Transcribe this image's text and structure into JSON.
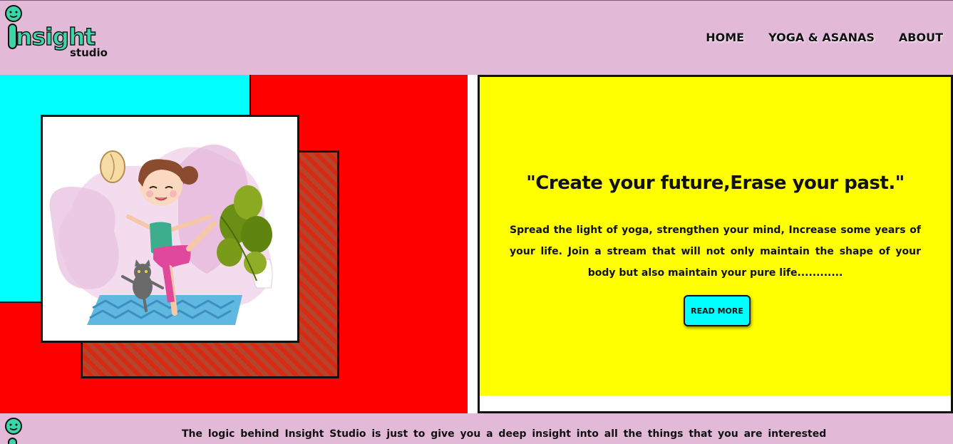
{
  "header": {
    "logo_word": "nsight",
    "logo_sub": "studio",
    "nav": [
      "HOME",
      "YOGA & ASANAS",
      "ABOUT"
    ]
  },
  "hero": {
    "quote": "\"Create your future,Erase your past.\"",
    "tagline": "Spread the light of yoga, strengthen your mind, Increase some years of your life. Join a stream that will not only maintain the shape of your body but also maintain your pure life............",
    "button_label": "READ MORE"
  },
  "footer": {
    "text": "The logic behind Insight Studio is just to give you a deep insight into all the things that you are interested"
  },
  "colors": {
    "header_bg": "#e2bad8",
    "accent_cyan": "#00ffff",
    "accent_red": "#ff0000",
    "panel_yellow": "#ffff00",
    "logo_green": "#3bd6a8"
  },
  "icons": [
    "logo-face-icon",
    "yoga-girl-illustration",
    "cat-illustration",
    "plant-illustration"
  ]
}
